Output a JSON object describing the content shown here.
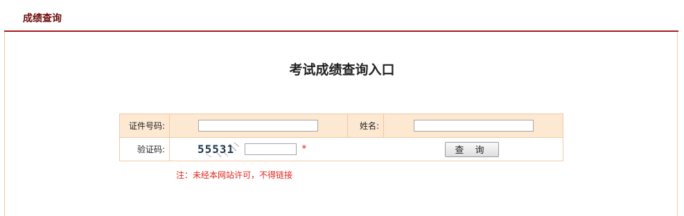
{
  "header": {
    "tab_title": "成绩查询"
  },
  "main": {
    "title": "考试成绩查询入口"
  },
  "form": {
    "id_label": "证件号码:",
    "id_value": "",
    "name_label": "姓名:",
    "name_value": "",
    "captcha_label": "验证码:",
    "captcha_text": "55531",
    "captcha_value": "",
    "required_mark": "*",
    "submit_label": "查 询"
  },
  "notice": "注：未经本网站许可，不得链接",
  "colors": {
    "accent_dark_red": "#a8191b",
    "tab_title": "#6b0a0a",
    "row_bg": "#fde8d2",
    "border": "#f2c8a3",
    "notice_red": "#e0231a"
  }
}
